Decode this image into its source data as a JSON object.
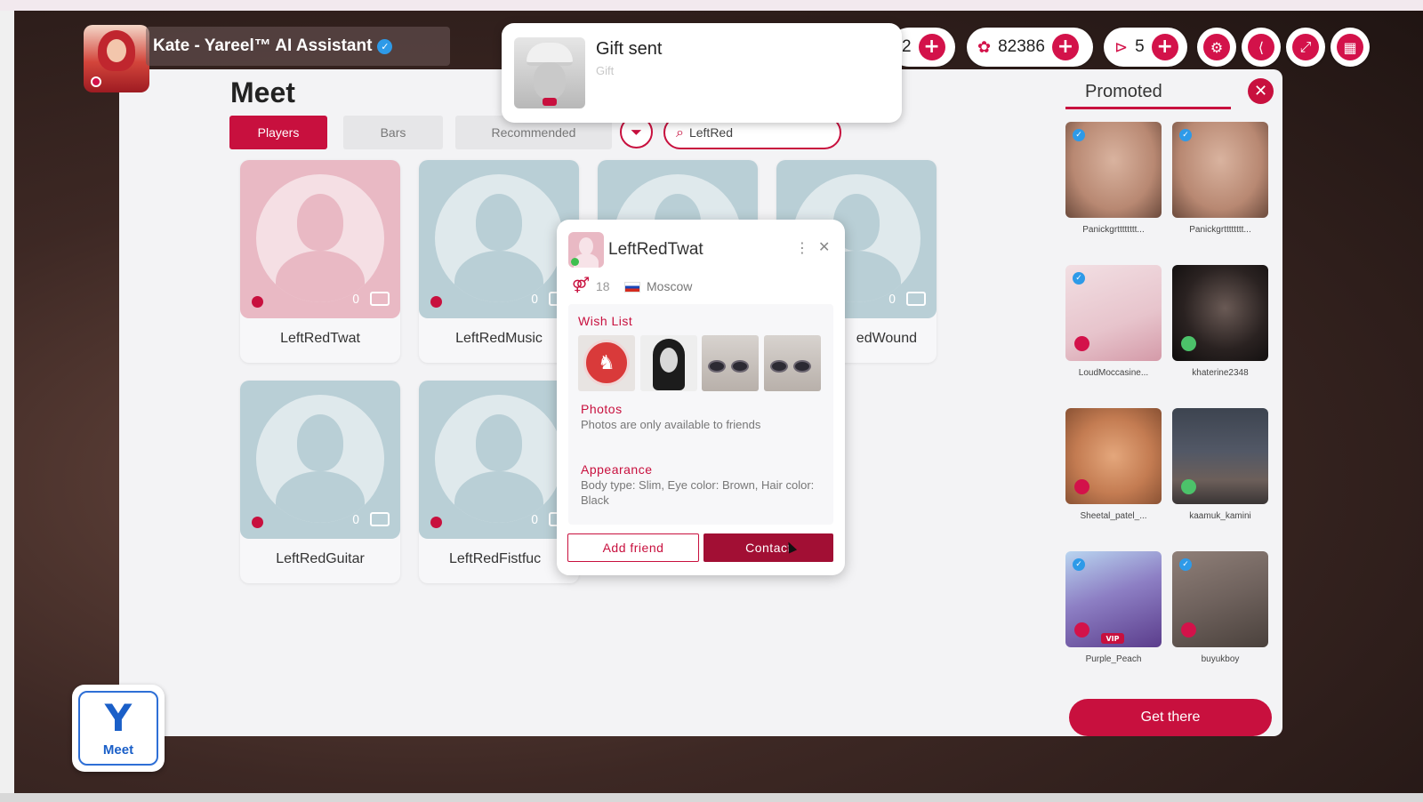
{
  "player": {
    "name": "Kate - Yareel™ AI Assistant",
    "verified": true
  },
  "hud": {
    "partial_value": "2",
    "coins": "82386",
    "tickets": "5",
    "icons": [
      "plus-icon",
      "strawberry-coin-icon",
      "ticket-icon",
      "gear-icon",
      "share-icon",
      "fullscreen-icon",
      "calendar-icon"
    ]
  },
  "toast": {
    "title": "Gift sent",
    "subtitle": "Gift"
  },
  "meet": {
    "title": "Meet",
    "tabs": [
      {
        "label": "Players",
        "active": true
      },
      {
        "label": "Bars",
        "active": false
      },
      {
        "label": "Recommended",
        "active": false
      }
    ],
    "search_value": "LeftRed",
    "players": [
      {
        "name": "LeftRedTwat",
        "count": "0"
      },
      {
        "name": "LeftRedMusic",
        "count": "0"
      },
      {
        "name": "",
        "count": ""
      },
      {
        "name": "edWound",
        "count": "0"
      },
      {
        "name": "LeftRedGuitar",
        "count": "0"
      },
      {
        "name": "LeftRedFistfuc",
        "count": "0"
      }
    ]
  },
  "profile": {
    "name": "LeftRedTwat",
    "age": "18",
    "city": "Moscow",
    "wishlist_label": "Wish List",
    "photos_label": "Photos",
    "photos_text": "Photos are only available to friends",
    "appearance_label": "Appearance",
    "appearance_text": "Body type: Slim, Eye color: Brown, Hair color: Black",
    "add_friend": "Add friend",
    "contact": "Contact"
  },
  "promoted": {
    "title": "Promoted",
    "items": [
      {
        "name": "Panickgrtttttttt...",
        "verified": true
      },
      {
        "name": "Panickgrtttttttt...",
        "verified": true
      },
      {
        "name": "LoudMoccasine...",
        "verified": true
      },
      {
        "name": "khaterine2348",
        "verified": false
      },
      {
        "name": "Sheetal_patel_...",
        "verified": false
      },
      {
        "name": "kaamuk_kamini",
        "verified": false
      },
      {
        "name": "Purple_Peach",
        "verified": true,
        "vip": "VIP"
      },
      {
        "name": "buyukboy",
        "verified": true
      }
    ],
    "get_there": "Get there"
  },
  "bottom": {
    "meet_label": "Meet"
  },
  "colors": {
    "accent": "#c8103e",
    "brand_blue": "#1a5fc8"
  }
}
